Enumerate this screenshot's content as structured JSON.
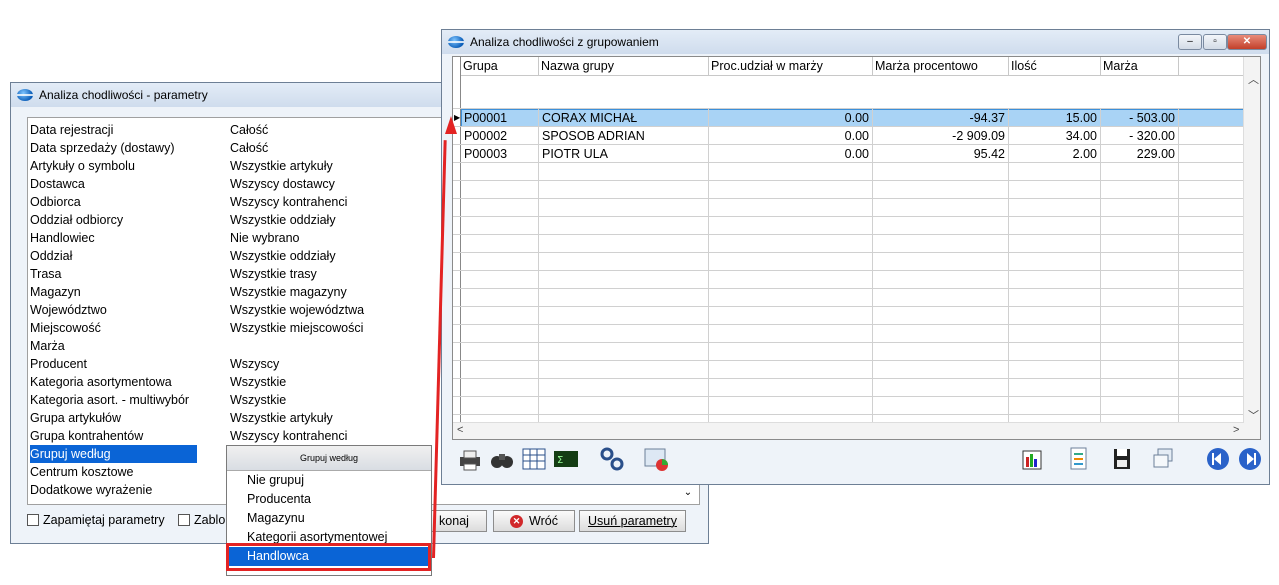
{
  "params_window": {
    "title": "Analiza chodliwości - parametry",
    "rows": [
      {
        "key": "Data rejestracji",
        "value": "Całość"
      },
      {
        "key": "Data sprzedaży (dostawy)",
        "value": "Całość"
      },
      {
        "key": "Artykuły o symbolu",
        "value": "Wszystkie artykuły"
      },
      {
        "key": "Dostawca",
        "value": "Wszyscy dostawcy"
      },
      {
        "key": "Odbiorca",
        "value": "Wszyscy kontrahenci"
      },
      {
        "key": "Oddział odbiorcy",
        "value": "Wszystkie oddziały"
      },
      {
        "key": "Handlowiec",
        "value": "Nie wybrano"
      },
      {
        "key": "Oddział",
        "value": "Wszystkie oddziały"
      },
      {
        "key": "Trasa",
        "value": "Wszystkie trasy"
      },
      {
        "key": "Magazyn",
        "value": "Wszystkie magazyny"
      },
      {
        "key": "Województwo",
        "value": "Wszystkie województwa"
      },
      {
        "key": "Miejscowość",
        "value": "Wszystkie miejscowości"
      },
      {
        "key": "Marża",
        "value": ""
      },
      {
        "key": "Producent",
        "value": "Wszyscy"
      },
      {
        "key": "Kategoria asortymentowa",
        "value": "Wszystkie"
      },
      {
        "key": "Kategoria asort. - multiwybór",
        "value": "Wszystkie"
      },
      {
        "key": "Grupa artykułów",
        "value": "Wszystkie artykuły"
      },
      {
        "key": "Grupa kontrahentów",
        "value": "Wszyscy kontrahenci"
      },
      {
        "key": "Grupuj według",
        "value": ""
      },
      {
        "key": "Centrum kosztowe",
        "value": ""
      },
      {
        "key": "Dodatkowe wyrażenie",
        "value": ""
      }
    ],
    "remember_label": "Zapamiętaj parametry",
    "lock_label": "Zablo",
    "execute_label": "konaj",
    "back_label": "Wróć",
    "clear_label": "Usuń parametry"
  },
  "dropdown": {
    "header": "Grupuj według",
    "items": [
      "Nie grupuj",
      "Producenta",
      "Magazynu",
      "Kategorii asortymentowej",
      "Handlowca"
    ],
    "selected": "Handlowca"
  },
  "analysis_window": {
    "title": "Analiza chodliwości z grupowaniem",
    "columns": [
      "Grupa",
      "Nazwa grupy",
      "Proc.udział w marży",
      "Marża procentowo",
      "Ilość",
      "Marża"
    ],
    "rows": [
      [
        "P00001",
        "CORAX MICHAŁ",
        "0.00",
        "-94.37",
        "15.00",
        "- 503.00"
      ],
      [
        "P00002",
        "SPOSOB ADRIAN",
        "0.00",
        "-2 909.09",
        "34.00",
        "- 320.00"
      ],
      [
        "P00003",
        "PIOTR ULA",
        "0.00",
        "95.42",
        "2.00",
        "229.00"
      ]
    ]
  },
  "colors": {
    "selection": "#0a64d6",
    "highlight_red": "#e32323",
    "row_selected": "#a9d3f5"
  }
}
